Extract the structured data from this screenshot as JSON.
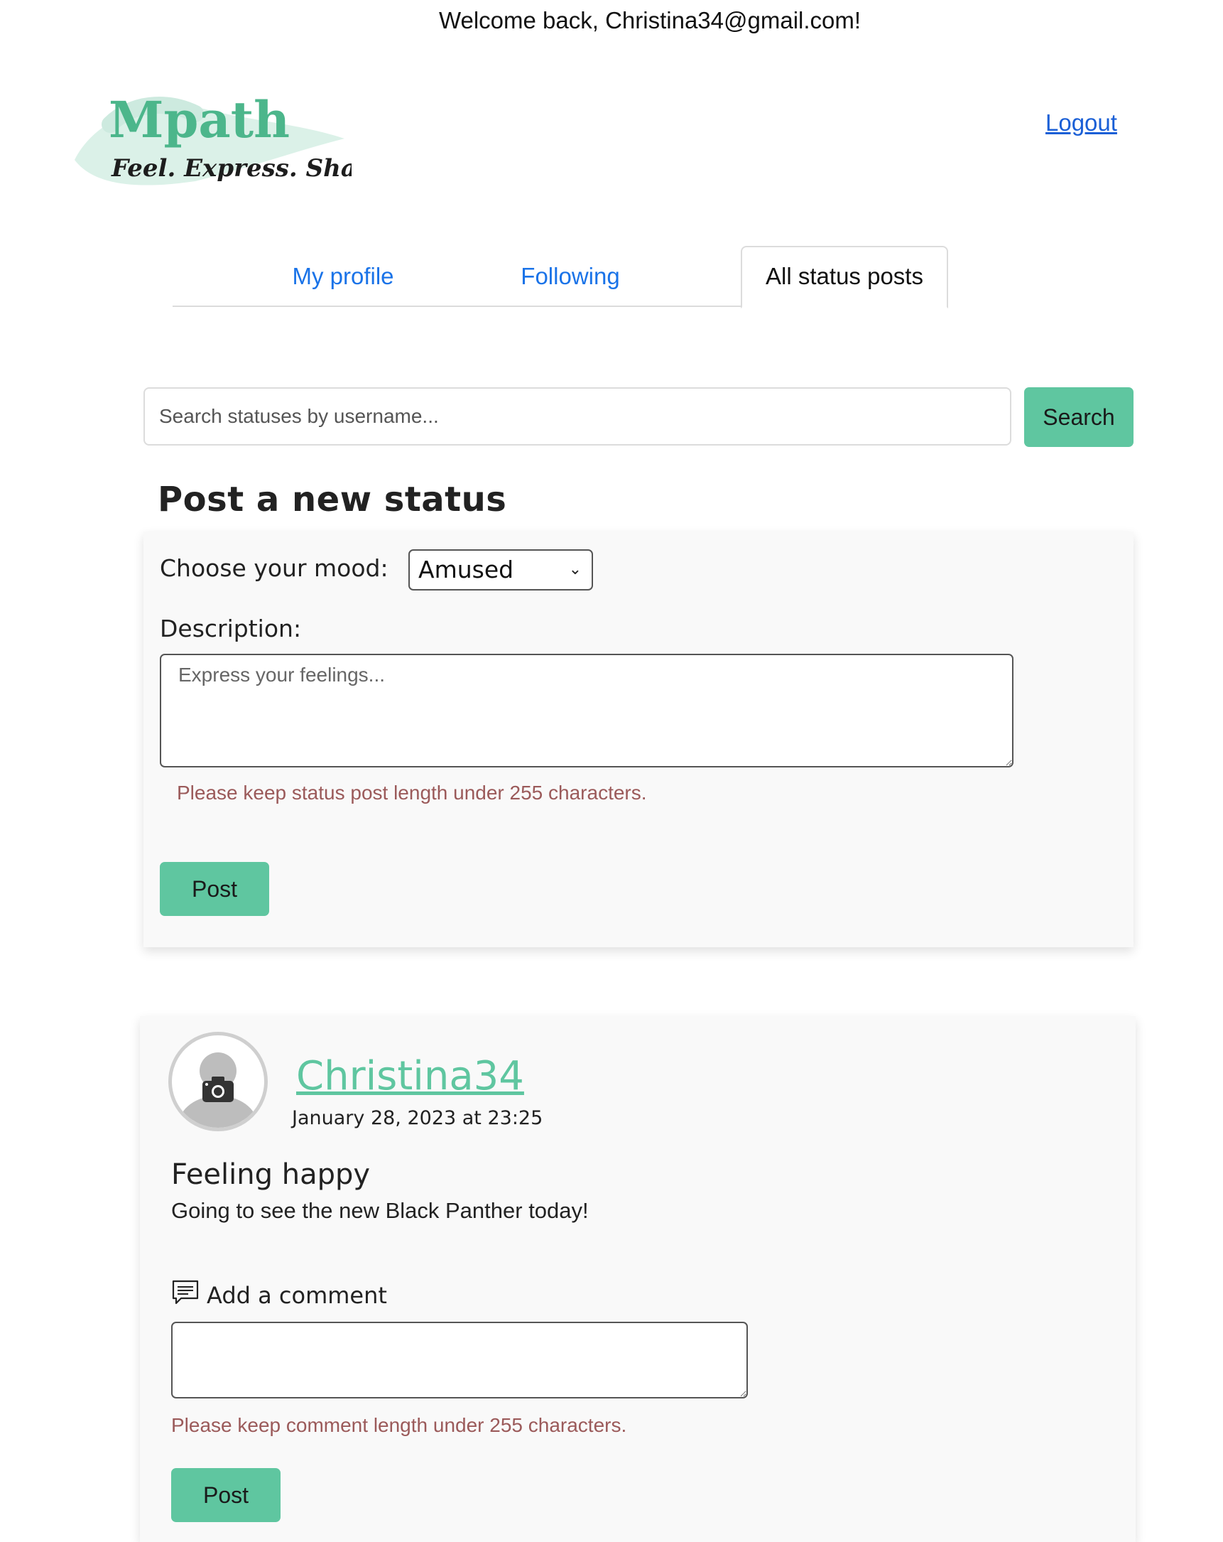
{
  "header": {
    "welcome": "Welcome back, Christina34@gmail.com!",
    "logo_word": "Mpath",
    "logo_tagline": "Feel. Express. Share.",
    "logout_label": "Logout"
  },
  "tabs": [
    {
      "label": "My profile",
      "active": false
    },
    {
      "label": "Following",
      "active": false
    },
    {
      "label": "All status posts",
      "active": true
    }
  ],
  "search": {
    "placeholder": "Search statuses by username...",
    "button_label": "Search"
  },
  "new_status": {
    "title": "Post a new status",
    "mood_label": "Choose your mood:",
    "mood_selected": "Amused",
    "description_label": "Description:",
    "description_placeholder": "Express your feelings...",
    "length_hint": "Please keep status post length under 255 characters.",
    "post_label": "Post"
  },
  "feed": [
    {
      "username": "Christina34",
      "timestamp": "January 28, 2023 at 23:25",
      "mood_title": "Feeling happy",
      "body": "Going to see the new Black Panther today!",
      "comment_heading": "Add a comment",
      "comment_hint": "Please keep comment length under 255 characters.",
      "comment_post_label": "Post"
    }
  ],
  "colors": {
    "accent": "#5fc6a0",
    "link": "#1a73e8",
    "hint": "#9b5a5a"
  }
}
